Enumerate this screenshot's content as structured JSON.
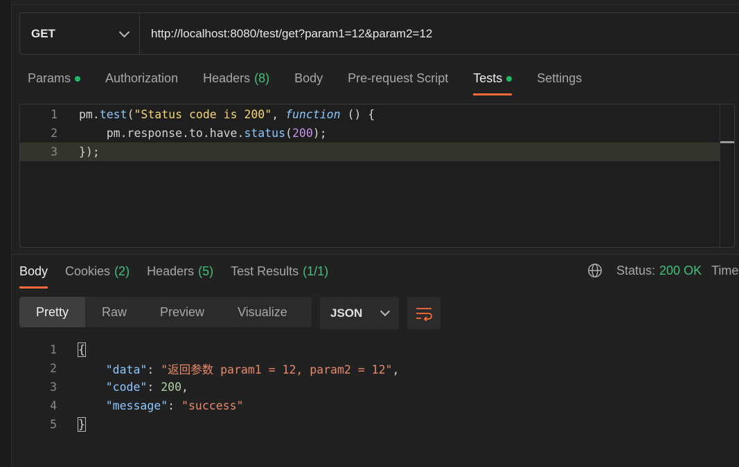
{
  "request": {
    "method": "GET",
    "url": "http://localhost:8080/test/get?param1=12&param2=12"
  },
  "request_tabs": [
    {
      "label": "Params",
      "dot": true
    },
    {
      "label": "Authorization"
    },
    {
      "label": "Headers",
      "count": "(8)"
    },
    {
      "label": "Body"
    },
    {
      "label": "Pre-request Script"
    },
    {
      "label": "Tests",
      "dot": true,
      "active": true
    },
    {
      "label": "Settings"
    }
  ],
  "tests_script": {
    "line_numbers": [
      "1",
      "2",
      "3"
    ],
    "line1": {
      "obj": "pm",
      "dot": ".",
      "fn": "test",
      "open": "(",
      "str": "\"Status code is 200\"",
      "comma": ", ",
      "kw": "function",
      "rest": " () {"
    },
    "line2": {
      "indent": "    ",
      "chain": "pm.response.to.have.",
      "fn": "status",
      "open": "(",
      "num": "200",
      "close": ");"
    },
    "line3": {
      "text": "});"
    }
  },
  "response_tabs": [
    {
      "label": "Body",
      "active": true
    },
    {
      "label": "Cookies",
      "count": "(2)"
    },
    {
      "label": "Headers",
      "count": "(5)"
    },
    {
      "label": "Test Results",
      "count": "(1/1)"
    }
  ],
  "status": {
    "label": "Status:",
    "value": "200 OK",
    "time_label": "Time"
  },
  "format_options": [
    "Pretty",
    "Raw",
    "Preview",
    "Visualize"
  ],
  "format_active": "Pretty",
  "language": "JSON",
  "response_body": {
    "line_numbers": [
      "1",
      "2",
      "3",
      "4",
      "5"
    ],
    "open_brace": "{",
    "close_brace": "}",
    "data_key": "\"data\"",
    "data_value": "\"返回参数 param1 = 12, param2 = 12\"",
    "code_key": "\"code\"",
    "code_value": "200",
    "message_key": "\"message\"",
    "message_value": "\"success\""
  },
  "icons": {
    "globe": "globe-icon",
    "wrap": "wrap-lines-icon",
    "chevron": "chevron-down-icon"
  },
  "colors": {
    "accent": "#ff6c37",
    "success": "#44c07b",
    "dot": "#1fb865"
  }
}
